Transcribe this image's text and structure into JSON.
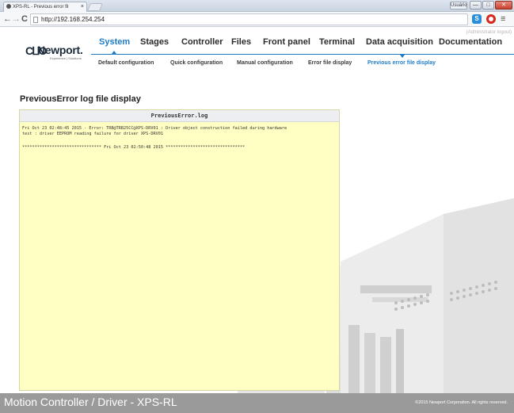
{
  "browser": {
    "tab_title": "XPS-RL - Previous error fil",
    "tab_close": "×",
    "user_label": "Usuário",
    "win_min": "—",
    "win_max": "□",
    "win_close": "✕",
    "back": "←",
    "forward": "→",
    "reload": "C",
    "url": "http://192.168.254.254",
    "ext_s": "S",
    "menu": "≡"
  },
  "header": {
    "logo_mark": "CⵡO",
    "logo_text": "Newport.",
    "logo_tagline": "Experience | Solutions",
    "admin_text": "(Administrator logout)"
  },
  "main_nav": [
    "System",
    "Stages",
    "Controller",
    "Files",
    "Front panel",
    "Terminal",
    "Data acquisition",
    "Documentation"
  ],
  "sub_nav": [
    "Default configuration",
    "Quick configuration",
    "Manual configuration",
    "Error file display",
    "Previous error file display"
  ],
  "content": {
    "page_title": "PreviousError log file display",
    "file_name": "PreviousError.log",
    "log_lines": [
      "Fri Oct 23 02:48:45 2015 - Error: TRB@TRB25CC@XPS-DRV01 : Driver object construction failed during hardware",
      "test : driver EEPROM reading failure for driver XPS-DRV01",
      "",
      "******************************** Fri Oct 23 02:50:48 2015 ********************************"
    ]
  },
  "footer": {
    "title": "Motion Controller / Driver - XPS-RL",
    "copyright": "©2015 Newport Corporation. All rights reserved."
  },
  "colors": {
    "accent": "#1f7bc5",
    "log_background": "#ffffc4",
    "footer_background": "#9a9a9a"
  }
}
